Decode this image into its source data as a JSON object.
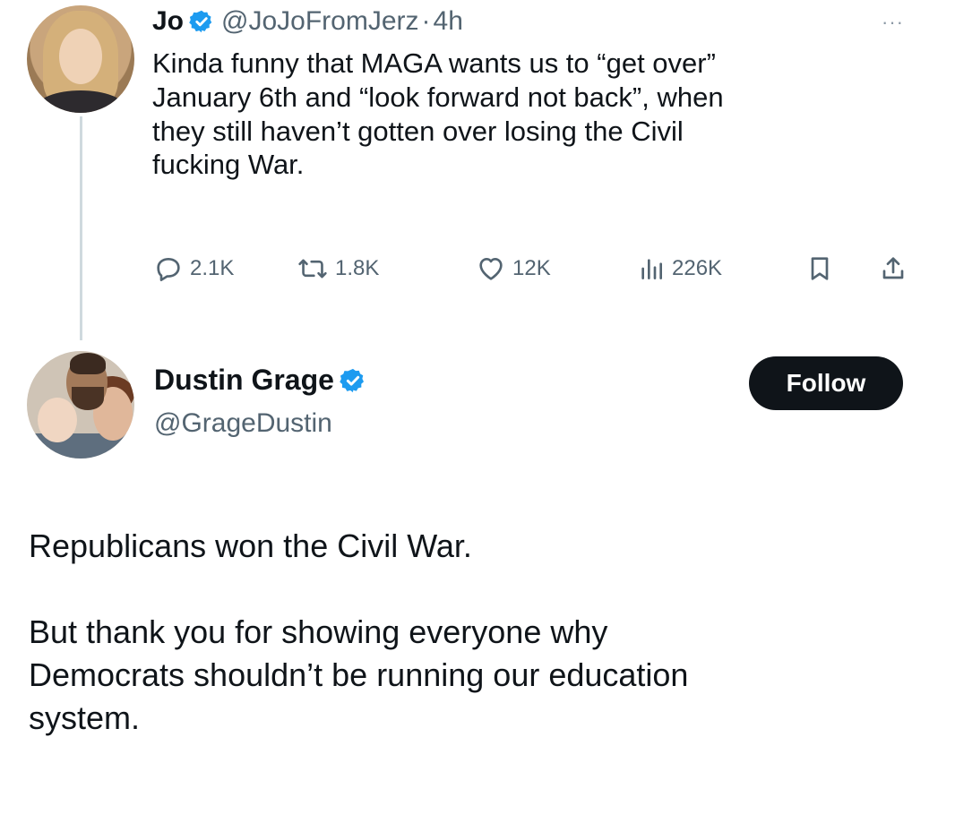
{
  "tweet1": {
    "author_name": "Jo",
    "author_handle": "@JoJoFromJerz",
    "separator": "·",
    "time": "4h",
    "more_label": "···",
    "body_lines": [
      "Kinda funny that MAGA wants us to “get over”",
      "January 6th and “look forward not back”, when",
      "they still haven’t gotten over losing the Civil",
      "fucking War."
    ],
    "stats": {
      "replies": "2.1K",
      "retweets": "1.8K",
      "likes": "12K",
      "views": "226K"
    },
    "icons": {
      "reply": "reply-icon",
      "retweet": "retweet-icon",
      "like": "heart-icon",
      "views": "views-chart-icon",
      "bookmark": "bookmark-icon",
      "share": "share-icon"
    }
  },
  "tweet2": {
    "author_name": "Dustin Grage",
    "author_handle": "@GrageDustin",
    "follow_label": "Follow",
    "paragraph1": "Republicans won the Civil War.",
    "paragraph2_lines": [
      "But thank you for showing everyone why",
      "Democrats shouldn’t be running our education",
      "system."
    ]
  },
  "colors": {
    "text": "#0f1419",
    "secondary": "#536471",
    "verified": "#1d9bf0",
    "follow_bg": "#0f1419",
    "thread_line": "#cfd9de"
  }
}
